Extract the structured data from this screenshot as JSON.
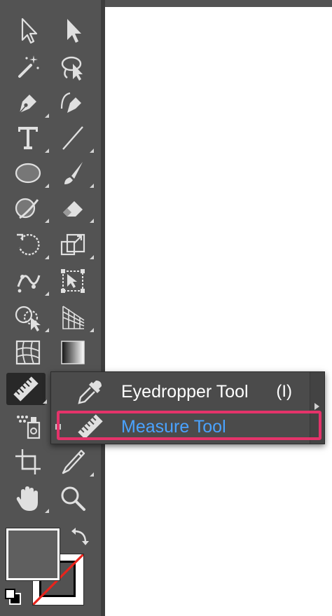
{
  "colors": {
    "panel": "#535353",
    "canvas": "#ffffff",
    "highlight": "#e4336a",
    "selected_text": "#4aa3ff"
  },
  "toolbar": {
    "tools": [
      {
        "name": "selection-tool",
        "icon": "selection-arrow-icon"
      },
      {
        "name": "direct-selection-tool",
        "icon": "direct-selection-arrow-icon"
      },
      {
        "name": "magic-wand-tool",
        "icon": "magic-wand-icon"
      },
      {
        "name": "lasso-tool",
        "icon": "lasso-icon"
      },
      {
        "name": "pen-tool",
        "icon": "pen-icon"
      },
      {
        "name": "curvature-tool",
        "icon": "curvature-pen-icon"
      },
      {
        "name": "type-tool",
        "icon": "type-icon",
        "glyph": "T"
      },
      {
        "name": "line-segment-tool",
        "icon": "line-segment-icon"
      },
      {
        "name": "ellipse-tool",
        "icon": "ellipse-icon"
      },
      {
        "name": "paintbrush-tool",
        "icon": "paintbrush-icon"
      },
      {
        "name": "shaper-tool",
        "icon": "shaper-icon"
      },
      {
        "name": "eraser-tool",
        "icon": "eraser-icon"
      },
      {
        "name": "rotate-tool",
        "icon": "rotate-icon"
      },
      {
        "name": "scale-tool",
        "icon": "scale-icon"
      },
      {
        "name": "puppet-warp-tool",
        "icon": "puppet-warp-icon"
      },
      {
        "name": "free-transform-tool",
        "icon": "free-transform-icon"
      },
      {
        "name": "shape-builder-tool",
        "icon": "shape-builder-icon"
      },
      {
        "name": "perspective-grid-tool",
        "icon": "perspective-grid-icon"
      },
      {
        "name": "mesh-tool",
        "icon": "mesh-icon"
      },
      {
        "name": "gradient-tool",
        "icon": "gradient-icon"
      },
      {
        "name": "measure-tool",
        "icon": "ruler-icon",
        "active": true
      },
      {
        "name": "symbol-sprayer-tool",
        "icon": "symbol-sprayer-icon"
      },
      {
        "name": "artboard-tool",
        "icon": "artboard-icon"
      },
      {
        "name": "slice-tool",
        "icon": "slice-icon"
      },
      {
        "name": "hand-tool",
        "icon": "hand-icon"
      },
      {
        "name": "zoom-tool",
        "icon": "zoom-icon"
      }
    ]
  },
  "flyout": {
    "items": [
      {
        "label": "Eyedropper Tool",
        "shortcut": "(I)",
        "icon": "eyedropper-icon",
        "selected": false
      },
      {
        "label": "Measure Tool",
        "shortcut": "",
        "icon": "ruler-icon",
        "selected": true
      }
    ]
  },
  "swatches": {
    "fill": "#5f5f5f",
    "stroke": "none"
  }
}
